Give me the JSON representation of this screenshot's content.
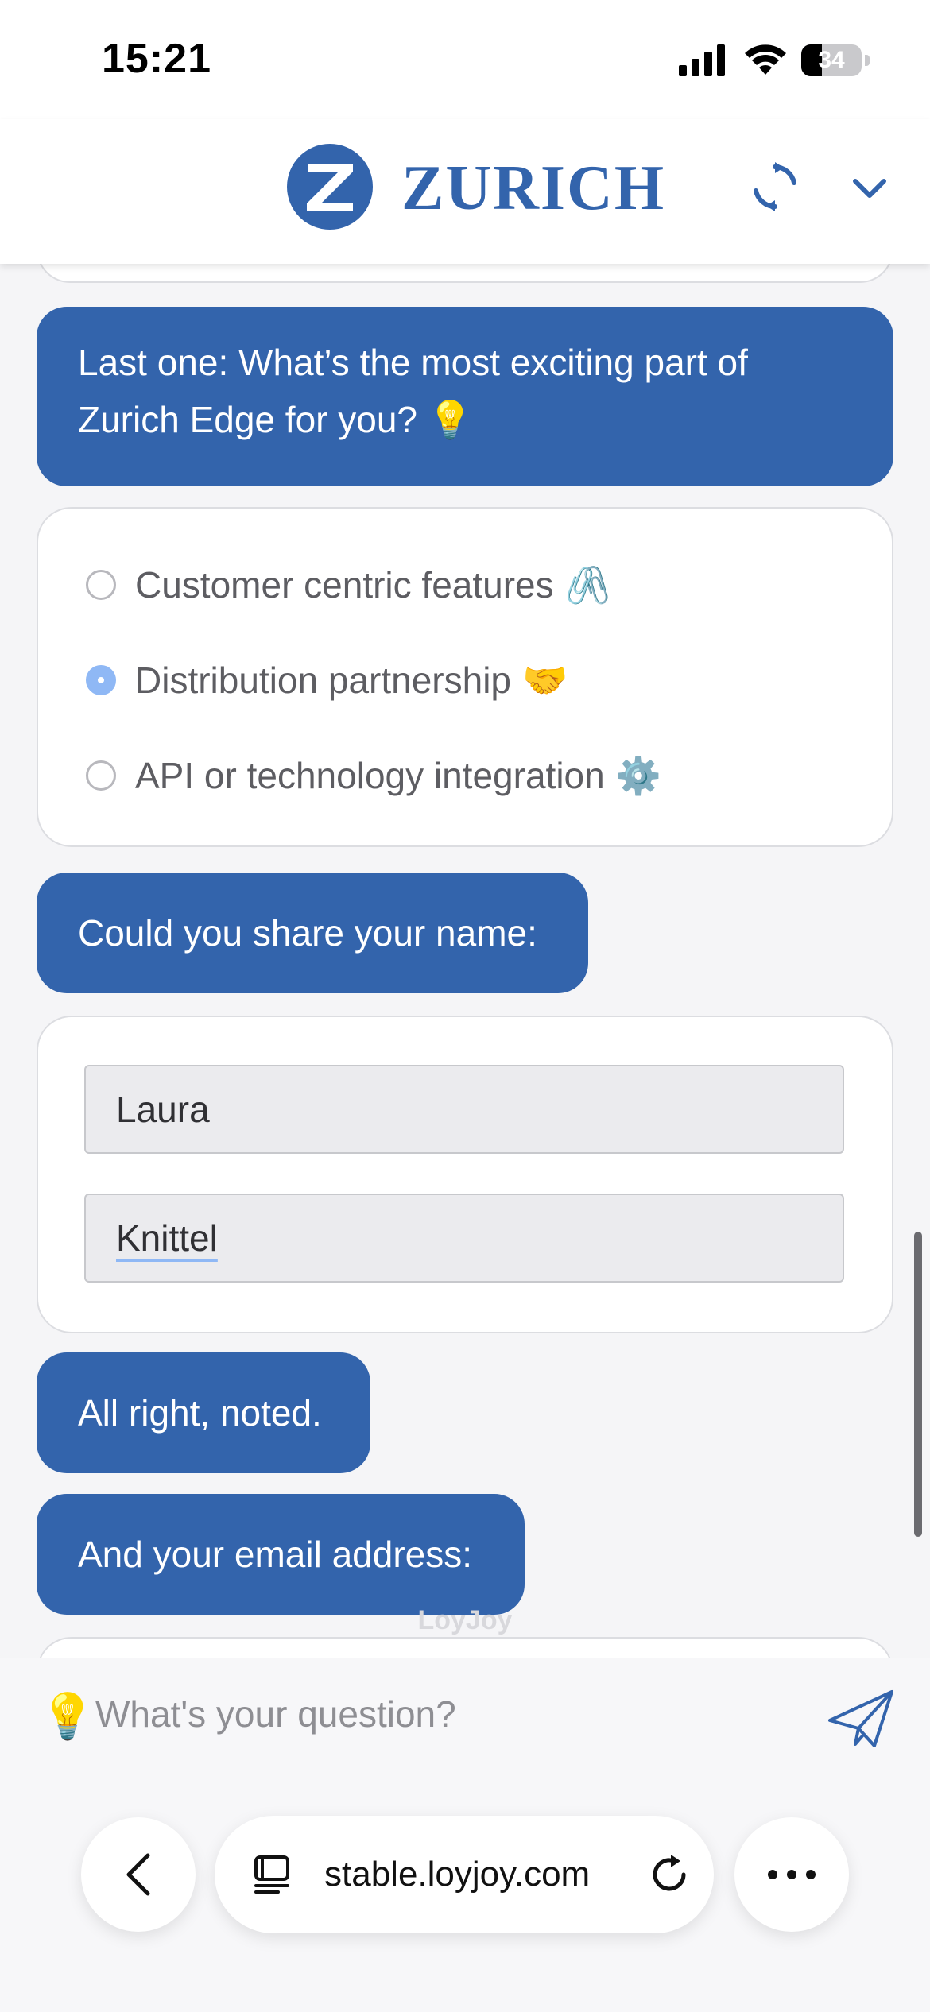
{
  "status_bar": {
    "time": "15:21",
    "battery": "34",
    "battery_level": 0.34
  },
  "header": {
    "brand": "ZURICH",
    "colors": {
      "brand": "#3364ac"
    },
    "icons": [
      "zurich-logo",
      "refresh-icon",
      "chevron-down-icon"
    ]
  },
  "chat": {
    "messages": [
      {
        "text": "Last one: What’s the most exciting part of Zurich Edge for you? 💡"
      },
      {
        "text": "Could you share your name:"
      },
      {
        "text": "All right, noted."
      },
      {
        "text": "And your email address:"
      }
    ],
    "options": [
      {
        "label": "Customer centric features",
        "emoji": "🖇️",
        "selected": false
      },
      {
        "label": "Distribution partnership",
        "emoji": "🤝",
        "selected": true
      },
      {
        "label": "API or technology integration",
        "emoji": "⚙️",
        "selected": false
      }
    ],
    "name_fields": [
      {
        "value": "Laura"
      },
      {
        "value": "Knittel"
      }
    ],
    "watermark": "LoyJoy"
  },
  "input_bar": {
    "icon": "💡",
    "placeholder": "What's your question?"
  },
  "browser": {
    "url": "stable.loyjoy.com"
  }
}
